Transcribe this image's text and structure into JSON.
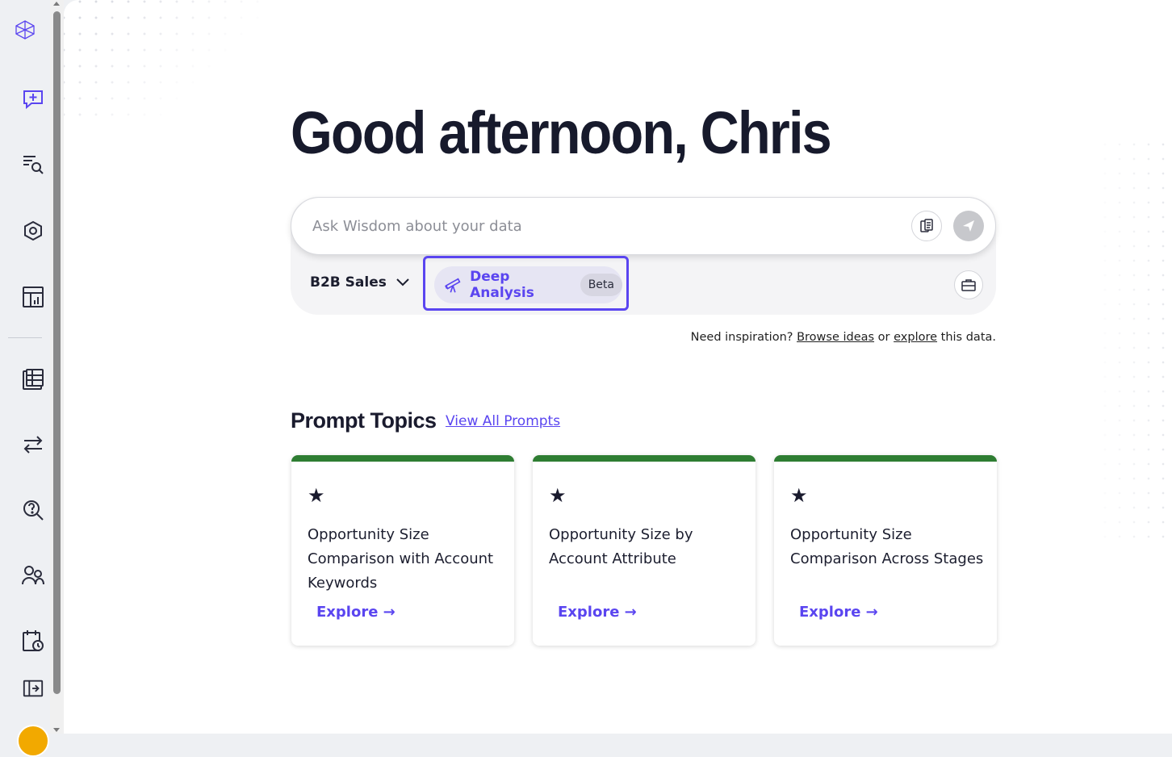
{
  "greeting": "Good afternoon, Chris",
  "ask": {
    "placeholder": "Ask Wisdom about your data",
    "dataset": "B2B Sales",
    "deep_analysis": "Deep Analysis",
    "beta": "Beta"
  },
  "inspiration": {
    "prefix": "Need inspiration?",
    "browse": "Browse ideas",
    "or": "or",
    "explore": "explore",
    "suffix": "this data."
  },
  "topics": {
    "title": "Prompt Topics",
    "view_all": "View All Prompts",
    "cards": [
      {
        "title": "Opportunity Size Comparison with Account Keywords",
        "action": "Explore →"
      },
      {
        "title": "Opportunity Size by Account Attribute",
        "action": "Explore →"
      },
      {
        "title": "Opportunity Size Comparison Across Stages",
        "action": "Explore →"
      }
    ]
  },
  "nav": [
    "logo-icon",
    "new-chat-icon",
    "search-list-icon",
    "hexagon-network-icon",
    "report-chart-icon",
    "table-icon",
    "transfer-icon",
    "help-search-icon",
    "users-icon",
    "calendar-clock-icon",
    "sidebar-expand-icon"
  ],
  "colors": {
    "accent": "#5a45f0",
    "card_top": "#2e7d32",
    "text": "#1a1b2e"
  }
}
